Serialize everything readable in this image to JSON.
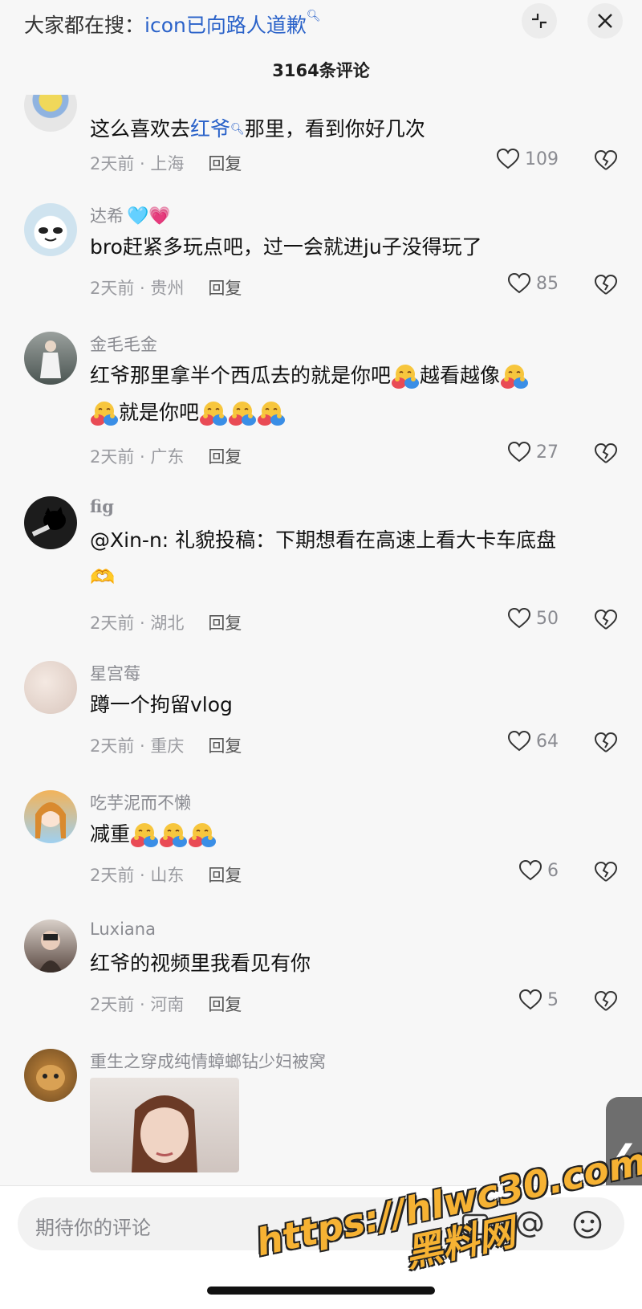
{
  "header": {
    "search_prefix": "大家都在搜：",
    "search_keyword": "icon已向路人道歉",
    "collapse_icon": "collapse-icon",
    "close_icon": "close-icon",
    "comment_count": "3164条评论"
  },
  "comments": [
    {
      "username": "",
      "text_parts": [
        "这么喜欢去",
        "红爷",
        "那里，看到你好几次"
      ],
      "time": "2天前",
      "location": "上海",
      "reply": "回复",
      "likes": "109"
    },
    {
      "username": "达希",
      "name_emojis": "🩵💗",
      "text": "bro赶紧多玩点吧，过一会就进ju子没得玩了",
      "time": "2天前",
      "location": "贵州",
      "reply": "回复",
      "likes": "85"
    },
    {
      "username": "金毛毛金",
      "text_line1": "红爷那里拿半个西瓜去的就是你吧",
      "text_mid": "越看越像",
      "text_line2": "就是你吧",
      "time": "2天前",
      "location": "广东",
      "reply": "回复",
      "likes": "27"
    },
    {
      "username": "fig",
      "text": "@Xin-n: 礼貌投稿：下期想看在高速上看大卡车底盘",
      "text_line2": "🫶",
      "time": "2天前",
      "location": "湖北",
      "reply": "回复",
      "likes": "50"
    },
    {
      "username": "星宫莓",
      "text": "蹲一个拘留vlog",
      "time": "2天前",
      "location": "重庆",
      "reply": "回复",
      "likes": "64"
    },
    {
      "username": "吃芋泥而不懒",
      "text": "减重",
      "time": "2天前",
      "location": "山东",
      "reply": "回复",
      "likes": "6"
    },
    {
      "username": "Luxiana",
      "text": "红爷的视频里我看见有你",
      "time": "2天前",
      "location": "河南",
      "reply": "回复",
      "likes": "5"
    },
    {
      "username": "重生之穿成纯情蟑螂钻少妇被窝"
    }
  ],
  "footer": {
    "input_placeholder": "期待你的评论",
    "watermark_url": "https://hlwc30.com",
    "watermark_name": "黑料网"
  },
  "colors": {
    "keyword_blue": "#2a62c9",
    "watermark_orange": "#f6b233"
  }
}
